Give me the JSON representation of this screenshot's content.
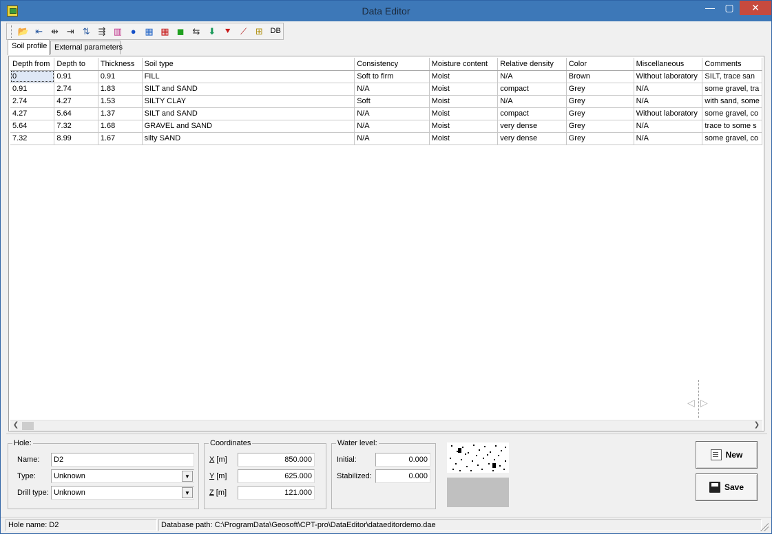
{
  "window": {
    "title": "Data Editor",
    "minimize_glyph": "—",
    "maximize_glyph": "▢",
    "close_glyph": "✕"
  },
  "toolbar": {
    "buttons": [
      {
        "name": "open-folder-icon",
        "glyph": "📂",
        "color": "#c8a030"
      },
      {
        "name": "insert-row-icon",
        "glyph": "⇤",
        "color": "#2a5aa0"
      },
      {
        "name": "delete-row-icon",
        "glyph": "⇹",
        "color": "#333333"
      },
      {
        "name": "append-row-icon",
        "glyph": "⇥",
        "color": "#333333"
      },
      {
        "name": "sort-az-icon",
        "glyph": "⇅",
        "color": "#2a5aa0"
      },
      {
        "name": "insert-column-icon",
        "glyph": "⇶",
        "color": "#333333"
      },
      {
        "name": "soil-column-icon",
        "glyph": "▥",
        "color": "#c0308a"
      },
      {
        "name": "water-drop-icon",
        "glyph": "●",
        "color": "#1450c8"
      },
      {
        "name": "blue-pattern-icon",
        "glyph": "▦",
        "color": "#2a6ac8"
      },
      {
        "name": "red-pattern-icon",
        "glyph": "▦",
        "color": "#c82020"
      },
      {
        "name": "color-palette-icon",
        "glyph": "◼",
        "color": "#20a020"
      },
      {
        "name": "swap-icon",
        "glyph": "⇆",
        "color": "#333333"
      },
      {
        "name": "download-arrow-icon",
        "glyph": "⬇",
        "color": "#1a9a5a"
      },
      {
        "name": "bookmark-icon",
        "glyph": "⯆",
        "color": "#c81818"
      },
      {
        "name": "chart-icon",
        "glyph": "⟋",
        "color": "#b01818"
      },
      {
        "name": "hierarchy-icon",
        "glyph": "⊞",
        "color": "#b09010"
      },
      {
        "name": "database-label",
        "glyph": "DB",
        "color": "#000000"
      }
    ]
  },
  "tabs": {
    "soil_profile": "Soil profile",
    "external_parameters": "External parameters"
  },
  "table": {
    "columns": [
      "Depth from",
      "Depth to",
      "Thickness",
      "Soil type",
      "Consistency",
      "Moisture content",
      "Relative density",
      "Color",
      "Miscellaneous",
      "Comments"
    ],
    "rows": [
      [
        "0",
        "0.91",
        "0.91",
        "FILL",
        "Soft to firm",
        "Moist",
        "N/A",
        "Brown",
        "Without laboratory",
        "SILT, trace san"
      ],
      [
        "0.91",
        "2.74",
        "1.83",
        "SILT and SAND",
        "N/A",
        "Moist",
        "compact",
        "Grey",
        "N/A",
        "some gravel, tra"
      ],
      [
        "2.74",
        "4.27",
        "1.53",
        "SILTY CLAY",
        "Soft",
        "Moist",
        "N/A",
        "Grey",
        "N/A",
        "with sand, some"
      ],
      [
        "4.27",
        "5.64",
        "1.37",
        "SILT and SAND",
        "N/A",
        "Moist",
        "compact",
        "Grey",
        "Without laboratory",
        "some gravel, co"
      ],
      [
        "5.64",
        "7.32",
        "1.68",
        "GRAVEL and SAND",
        "N/A",
        "Moist",
        "very dense",
        "Grey",
        "N/A",
        "trace to some s"
      ],
      [
        "7.32",
        "8.99",
        "1.67",
        "silty SAND",
        "N/A",
        "Moist",
        "very dense",
        "Grey",
        "N/A",
        "some gravel, co"
      ]
    ]
  },
  "hole": {
    "legend": "Hole:",
    "name_label": "Name:",
    "name_value": "D2",
    "type_label": "Type:",
    "type_value": "Unknown",
    "drill_type_label": "Drill type:",
    "drill_type_value": "Unknown"
  },
  "coordinates": {
    "legend": "Coordinates",
    "x_letter": "X",
    "y_letter": "Y",
    "z_letter": "Z",
    "unit": " [m]",
    "x_value": "850.000",
    "y_value": "625.000",
    "z_value": "121.000"
  },
  "water_level": {
    "legend": "Water level:",
    "initial_label": "Initial:",
    "initial_value": "0.000",
    "stabilized_label": "Stabilized:",
    "stabilized_value": "0.000"
  },
  "buttons": {
    "new_label": "New",
    "save_label": "Save"
  },
  "status": {
    "hole_name": "Hole name: D2",
    "database_path": "Database path: C:\\ProgramData\\Geosoft\\CPT-pro\\DataEditor\\dataeditordemo.dae"
  },
  "colors": {
    "titlebar": "#3d78b8",
    "close_button": "#c74a3e",
    "swatch": "#c0c0c0"
  }
}
